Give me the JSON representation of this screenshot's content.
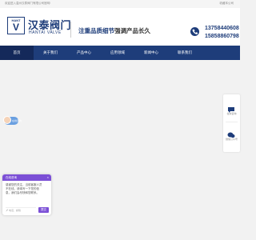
{
  "topbar": {
    "welcome": "欢迎进入温州汉泰阀门有限公司官网!",
    "favorite": "收藏本公司"
  },
  "header": {
    "logo_hant": "HANT",
    "logo_v": "V",
    "brand_cn": "汉泰阀门",
    "brand_en": "HANTAI VALVE",
    "slogan_highlight": "注重品质细节",
    "slogan_rest": "强调产品长久",
    "phone_1": "13758440608",
    "phone_2": "15858860798"
  },
  "nav": {
    "items": [
      {
        "label": "首页"
      },
      {
        "label": "关于我们"
      },
      {
        "label": "产品中心"
      },
      {
        "label": "应用领域"
      },
      {
        "label": "新闻中心"
      },
      {
        "label": "联系我们"
      }
    ],
    "active_index": 0
  },
  "side_float": {
    "online": "在线咨询",
    "wechat": "微信公众号"
  },
  "consult_tag": {
    "label": "在线咨询"
  },
  "chat": {
    "title": "在线咨询",
    "close": "×",
    "message": "感谢您的关注，当前客服人员不在线，请填写一下您的信息，我们会尽快和您联系。",
    "placeholder": "电话、邮箱",
    "send": "提交"
  },
  "colors": {
    "brand_blue": "#1e3d7a",
    "chat_purple": "#7b4fd6"
  }
}
